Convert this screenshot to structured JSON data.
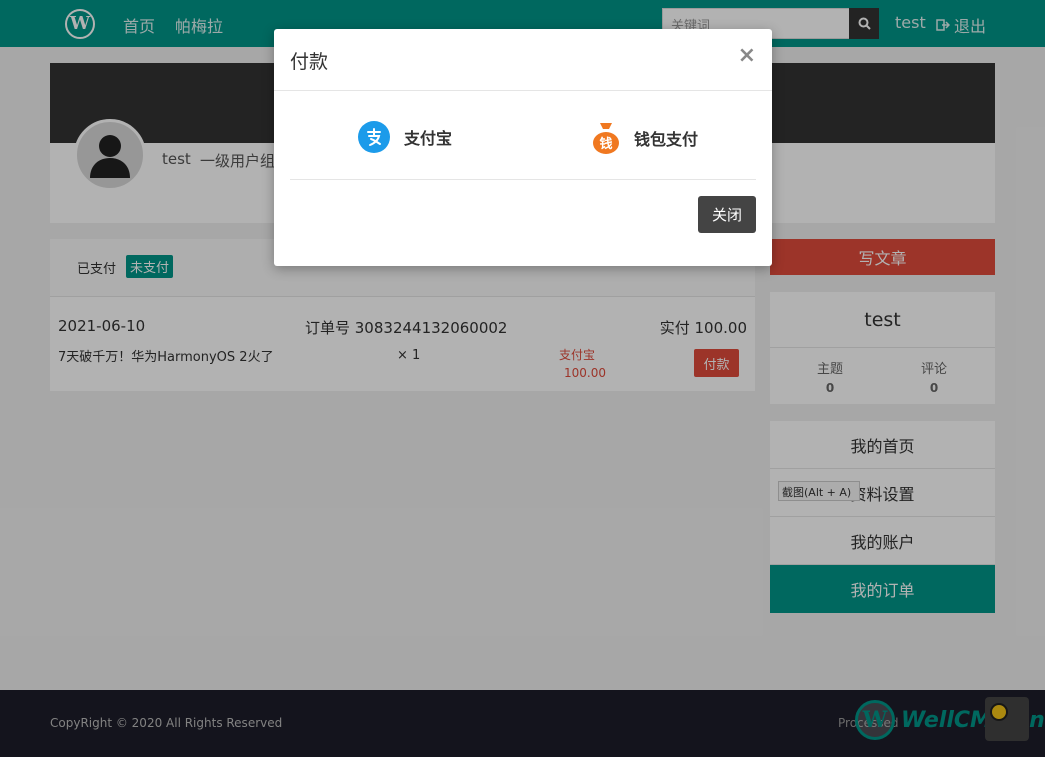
{
  "navbar": {
    "logo": "W",
    "links": [
      "首页",
      "帕梅拉"
    ],
    "search_placeholder": "关键词",
    "user": "test",
    "logout": "退出"
  },
  "profile": {
    "name": "test",
    "group": "一级用户组"
  },
  "orders": {
    "tab_paid": "已支付",
    "tab_unpaid": "未支付",
    "item": {
      "date": "2021-06-10",
      "order_no": "订单号 3083244132060002",
      "paid_total": "实付 100.00",
      "title": "7天破千万！华为HarmonyOS 2火了",
      "qty": "× 1",
      "method": "支付宝",
      "amount": "100.00",
      "pay_label": "付款"
    }
  },
  "sidebar": {
    "write_label": "写文章",
    "user_name": "test",
    "stats": [
      {
        "label": "主题",
        "value": "0"
      },
      {
        "label": "评论",
        "value": "0"
      }
    ],
    "menu": [
      {
        "label": "我的首页"
      },
      {
        "label": "资料设置"
      },
      {
        "label": "我的账户"
      },
      {
        "label": "我的订单"
      }
    ],
    "tooltip": "截图(Alt + A)"
  },
  "footer": {
    "copyright": "CopyRight © 2020 All Rights Reserved",
    "processed": "Processed",
    "watermark": "WellCMS.cn"
  },
  "modal": {
    "title": "付款",
    "close_x": "×",
    "options": [
      {
        "label": "支付宝",
        "icon": "alipay-icon"
      },
      {
        "label": "钱包支付",
        "icon": "wallet-icon",
        "icon_text": "钱"
      }
    ],
    "close_label": "关闭"
  },
  "colors": {
    "brand": "#009688",
    "danger": "#e04b3c",
    "alipay": "#1c9bea",
    "wallet": "#f07820"
  }
}
